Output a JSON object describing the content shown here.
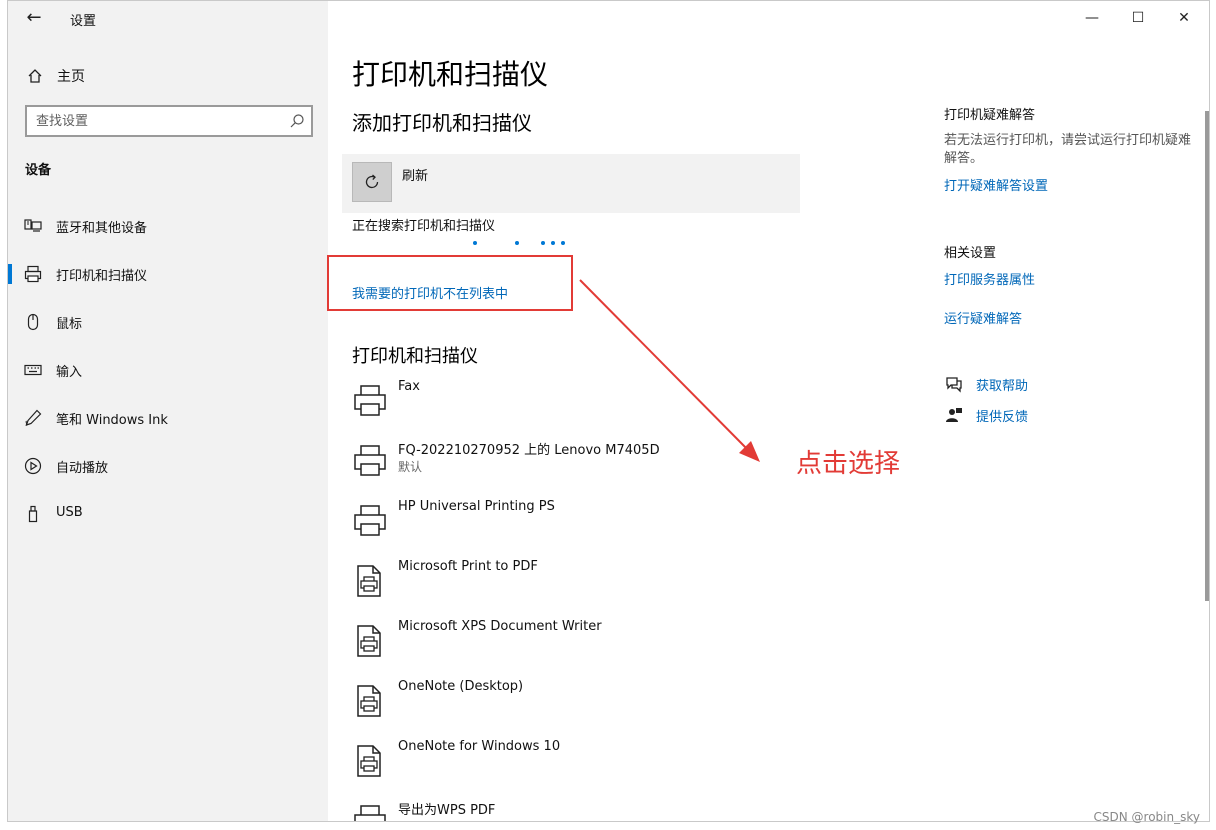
{
  "titlebar": {
    "title": "设置",
    "back": "←",
    "minimize": "—",
    "maximize": "☐",
    "close": "✕"
  },
  "sidebar": {
    "home_label": "主页",
    "search_placeholder": "查找设置",
    "section": "设备",
    "items": [
      {
        "label": "蓝牙和其他设备",
        "icon": "bluetooth-devices-icon",
        "selected": false
      },
      {
        "label": "打印机和扫描仪",
        "icon": "printer-icon",
        "selected": true
      },
      {
        "label": "鼠标",
        "icon": "mouse-icon",
        "selected": false
      },
      {
        "label": "输入",
        "icon": "keyboard-icon",
        "selected": false
      },
      {
        "label": "笔和 Windows Ink",
        "icon": "pen-icon",
        "selected": false
      },
      {
        "label": "自动播放",
        "icon": "autoplay-icon",
        "selected": false
      },
      {
        "label": "USB",
        "icon": "usb-icon",
        "selected": false
      }
    ]
  },
  "main": {
    "title": "打印机和扫描仪",
    "add_title": "添加打印机和扫描仪",
    "refresh_label": "刷新",
    "searching_text": "正在搜索打印机和扫描仪",
    "missing_link": "我需要的打印机不在列表中",
    "list_title": "打印机和扫描仪",
    "printers": [
      {
        "name": "Fax",
        "status": "",
        "icon": "printer-icon"
      },
      {
        "name": "FQ-202210270952 上的 Lenovo M7405D",
        "status": "默认",
        "icon": "network-printer-icon"
      },
      {
        "name": "HP Universal Printing PS",
        "status": "",
        "icon": "printer-icon"
      },
      {
        "name": "Microsoft Print to PDF",
        "status": "",
        "icon": "document-printer-icon"
      },
      {
        "name": "Microsoft XPS Document Writer",
        "status": "",
        "icon": "document-printer-icon"
      },
      {
        "name": "OneNote (Desktop)",
        "status": "",
        "icon": "document-printer-icon"
      },
      {
        "name": "OneNote for Windows 10",
        "status": "",
        "icon": "document-printer-icon"
      },
      {
        "name": "导出为WPS PDF",
        "status": "",
        "icon": "printer-icon"
      }
    ]
  },
  "right": {
    "troubleshoot_header": "打印机疑难解答",
    "troubleshoot_text": "若无法运行打印机，请尝试运行打印机疑难解答。",
    "troubleshoot_link": "打开疑难解答设置",
    "related_header": "相关设置",
    "print_server_link": "打印服务器属性",
    "run_troubleshoot_link": "运行疑难解答",
    "get_help": "获取帮助",
    "feedback": "提供反馈"
  },
  "annotation": {
    "text": "点击选择",
    "color": "#e23b36"
  },
  "watermark": "CSDN @robin_sky",
  "colors": {
    "accent": "#0078d4",
    "link": "#0067b8",
    "sidebar_bg": "#f2f2f2"
  }
}
